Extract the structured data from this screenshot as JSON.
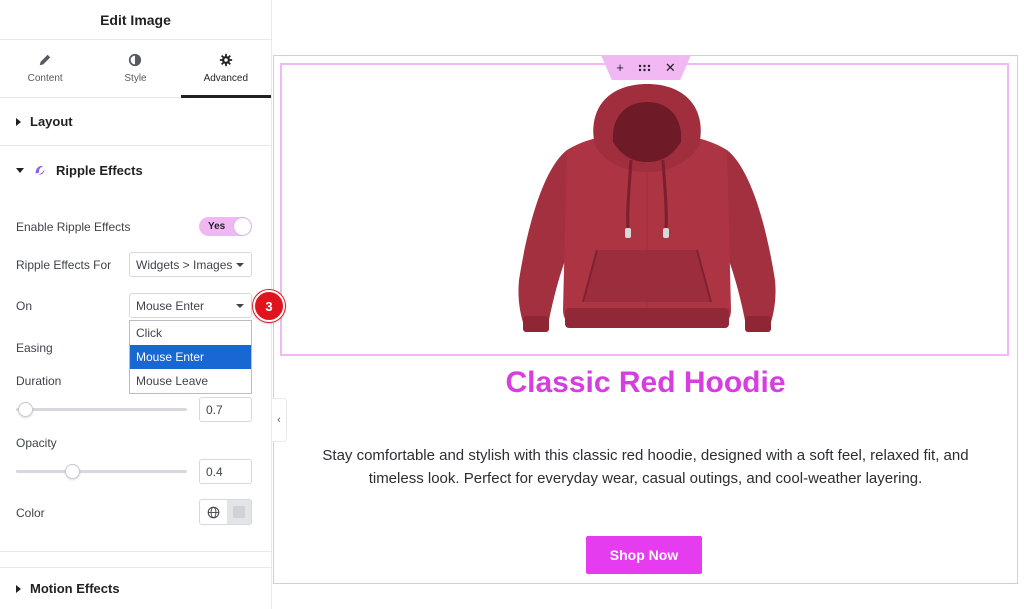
{
  "panel": {
    "title": "Edit Image",
    "tabs": [
      {
        "label": "Content",
        "icon": "pencil-icon"
      },
      {
        "label": "Style",
        "icon": "half-circle-icon"
      },
      {
        "label": "Advanced",
        "icon": "gear-icon",
        "active": true
      }
    ],
    "sections": {
      "layout": "Layout",
      "ripple": "Ripple Effects",
      "motion": "Motion Effects"
    },
    "ripple": {
      "enable_label": "Enable Ripple Effects",
      "enable_value": "Yes",
      "for_label": "Ripple Effects For",
      "for_value": "Widgets > Images",
      "on_label": "On",
      "on_value": "Mouse Enter",
      "on_options": [
        "Click",
        "Mouse Enter",
        "Mouse Leave"
      ],
      "easing_label": "Easing",
      "duration_label": "Duration",
      "duration_value": "0.7",
      "opacity_label": "Opacity",
      "opacity_value": "0.4",
      "color_label": "Color"
    },
    "step_badge": "3"
  },
  "canvas": {
    "handle_icons": [
      "plus-icon",
      "drag-icon",
      "close-icon"
    ],
    "product_title": "Classic Red Hoodie",
    "product_description": "Stay comfortable and stylish with this classic red hoodie, designed with a soft feel, relaxed fit, and timeless look. Perfect for everyday wear, casual outings, and cool-weather layering.",
    "button_label": "Shop Now"
  },
  "colors": {
    "accent": "#e63cf0",
    "title": "#d63ee0",
    "outline": "#f0b9f3",
    "selected_option": "#1967d2",
    "badge": "#e0141e",
    "hoodie": "#a83444"
  }
}
